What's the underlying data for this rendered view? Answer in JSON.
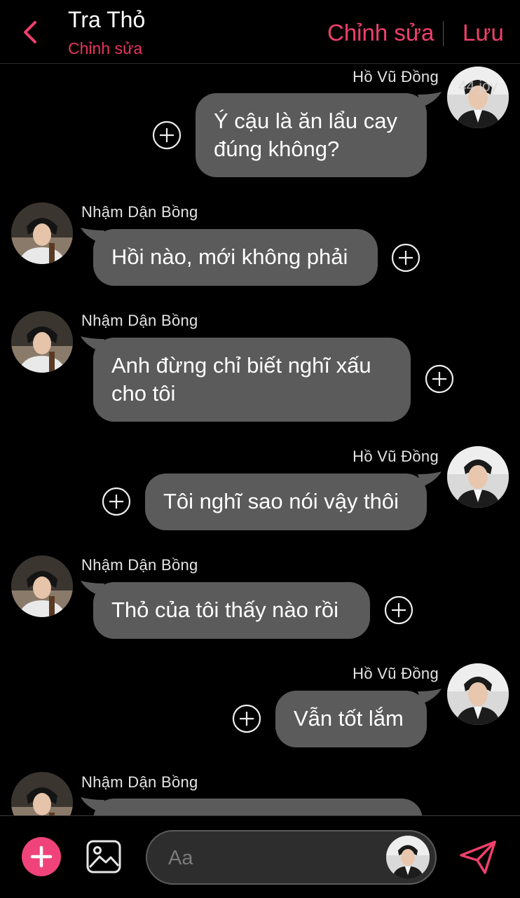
{
  "header": {
    "title": "Tra Thỏ",
    "subtitle": "Chỉnh sửa",
    "edit_label": "Chỉnh sửa",
    "save_label": "Lưu"
  },
  "watermark": "44 joy",
  "messages": [
    {
      "sender": "Hồ Vũ Đồng",
      "side": "right",
      "lines": [
        "Ý cậu là ăn lẩu cay",
        "đúng không?"
      ]
    },
    {
      "sender": "Nhậm Dận Bồng",
      "side": "left",
      "lines": [
        "Hồi nào, mới không phải"
      ]
    },
    {
      "sender": "Nhậm Dận Bồng",
      "side": "left",
      "lines": [
        "Anh đừng chỉ biết nghĩ xấu",
        "cho tôi"
      ]
    },
    {
      "sender": "Hồ Vũ Đồng",
      "side": "right",
      "lines": [
        "Tôi nghĩ sao nói vậy thôi"
      ]
    },
    {
      "sender": "Nhậm Dận Bồng",
      "side": "left",
      "lines": [
        "Thỏ của tôi thấy nào rồi"
      ]
    },
    {
      "sender": "Hồ Vũ Đồng",
      "side": "right",
      "lines": [
        "Vẫn tốt lắm"
      ]
    },
    {
      "sender": "Nhậm Dận Bồng",
      "side": "left",
      "lines": []
    }
  ],
  "composer": {
    "placeholder": "Aa"
  },
  "colors": {
    "accent": "#f0406b",
    "bubble": "#5b5b5b",
    "background": "#000000"
  },
  "icons": {
    "back": "chevron-left-icon",
    "add": "plus-icon",
    "image": "image-icon",
    "send": "send-icon",
    "react": "plus-circle-icon"
  }
}
